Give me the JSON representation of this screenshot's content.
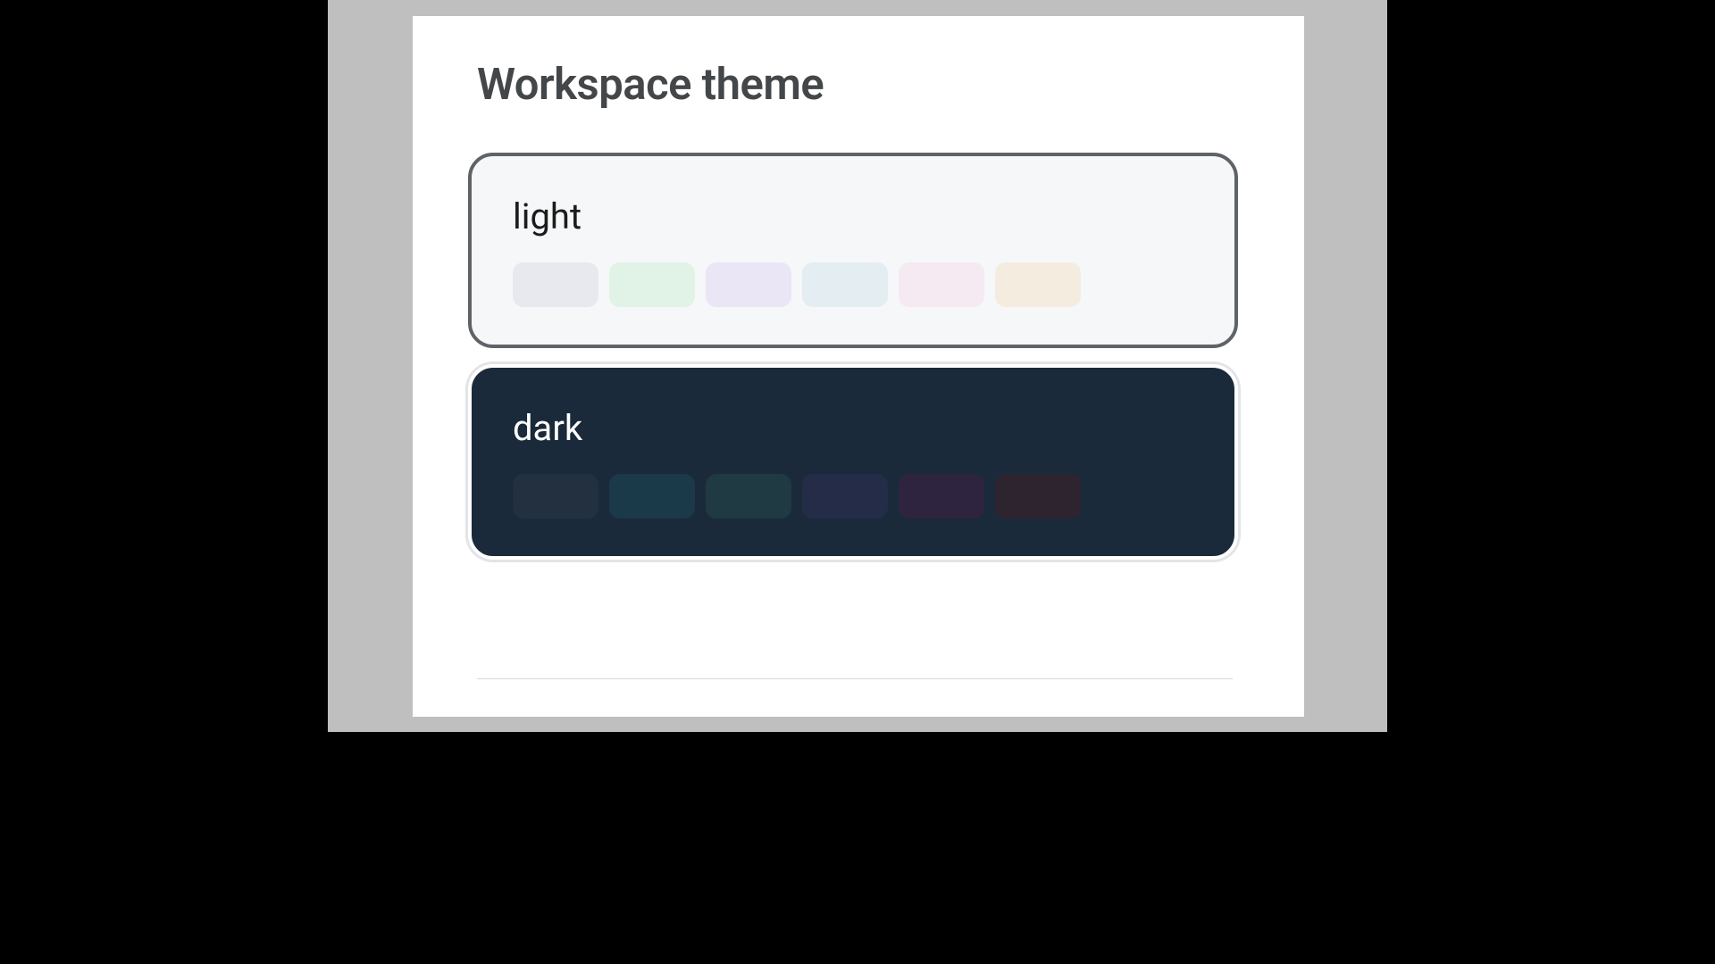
{
  "section_title": "Workspace theme",
  "themes": {
    "light": {
      "label": "light",
      "selected": true,
      "swatches": [
        "#e7e9ee",
        "#e1f2e6",
        "#ebe6f5",
        "#e3edf2",
        "#f5e9f2",
        "#f5ece0"
      ]
    },
    "dark": {
      "label": "dark",
      "selected": false,
      "swatches": [
        "#22303f",
        "#1a3a4a",
        "#1f3a42",
        "#242c48",
        "#2e2440",
        "#2e2430"
      ]
    }
  }
}
